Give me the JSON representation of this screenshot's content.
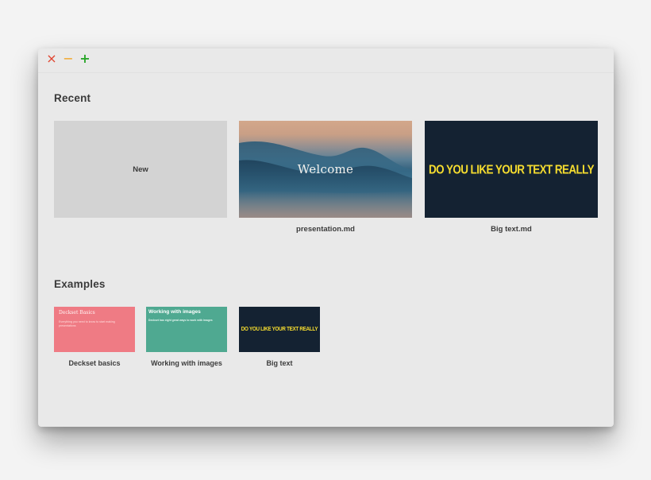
{
  "window": {
    "controls": {
      "close_icon": "close-icon",
      "minimize_icon": "minimize-icon",
      "zoom_icon": "zoom-icon",
      "close_glyph": "×",
      "minimize_glyph": "−",
      "zoom_glyph": "+"
    }
  },
  "recent": {
    "title": "Recent",
    "items": [
      {
        "label": "New",
        "caption": ""
      },
      {
        "thumb_text": "Welcome",
        "caption": "presentation.md"
      },
      {
        "thumb_text": "DO YOU LIKE YOUR TEXT REALLY",
        "caption": "Big text.md"
      }
    ]
  },
  "examples": {
    "title": "Examples",
    "items": [
      {
        "thumb_title": "Deckset Basics",
        "thumb_body": "Everything you need to know to start making presentations",
        "caption": "Deckset basics"
      },
      {
        "thumb_title": "Working with images",
        "thumb_body": "Deckset has eight great ways to work with images",
        "caption": "Working with images"
      },
      {
        "thumb_title": "DO YOU LIKE YOUR TEXT REALLY",
        "caption": "Big text"
      }
    ]
  },
  "colors": {
    "window_bg": "#e9e9e9",
    "close": "#e0442f",
    "minimize": "#f3a21c",
    "zoom": "#2aa62a",
    "new_thumb": "#d3d3d3",
    "bigtext_bg": "#142232",
    "bigtext_fg": "#f5dc2f",
    "basics_bg": "#ef7b84",
    "images_bg": "#4fa991"
  }
}
